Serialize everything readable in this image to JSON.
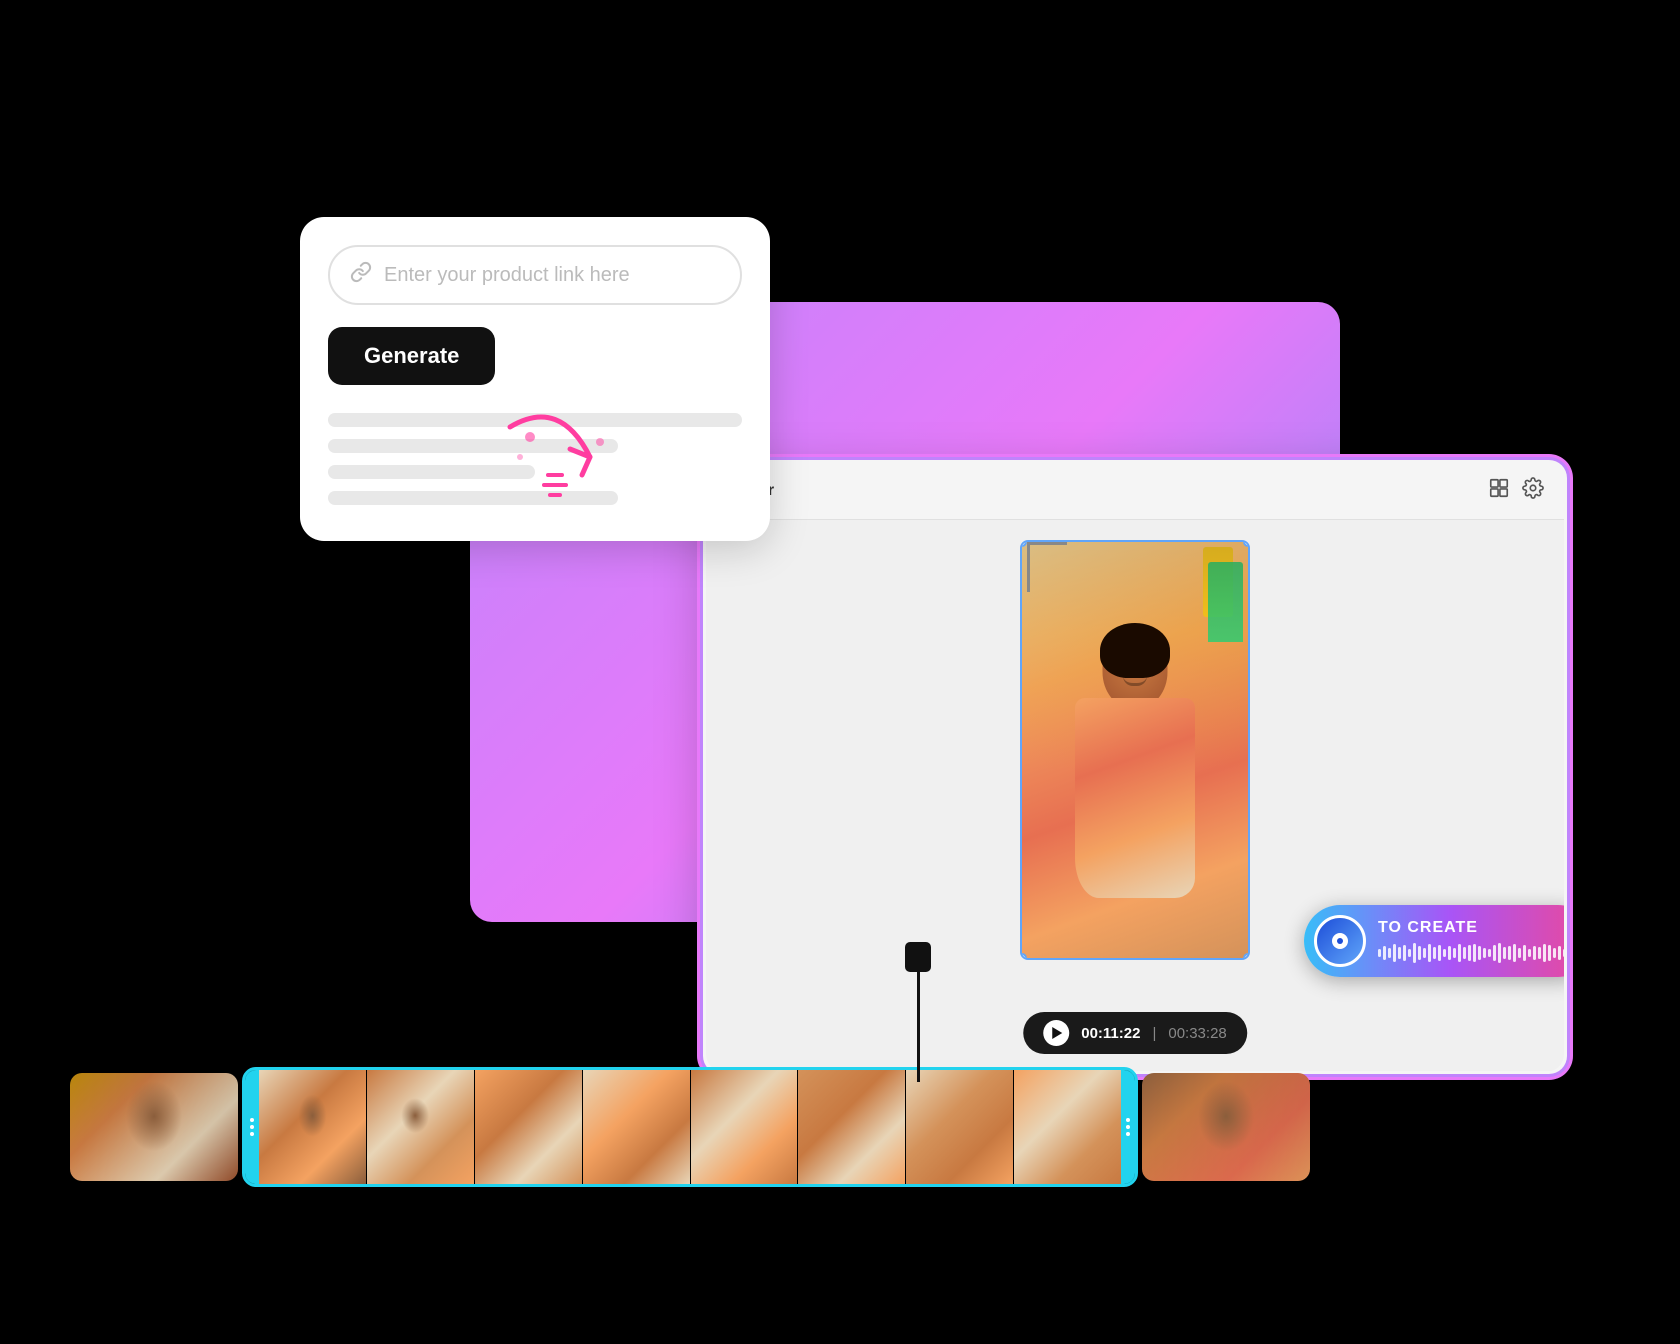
{
  "background": "#000000",
  "product_card": {
    "placeholder": "Enter your product link here",
    "generate_button": "Generate"
  },
  "player": {
    "label": "Player",
    "time_current": "00:11:22",
    "time_total": "00:33:28"
  },
  "music_badge": {
    "label": "TO CREATE",
    "waveform_bars": [
      8,
      14,
      10,
      18,
      12,
      16,
      8,
      20,
      14,
      10,
      18,
      12,
      16,
      8,
      14,
      10,
      18,
      12,
      16,
      18,
      14,
      10,
      8,
      16,
      20,
      12,
      14,
      18,
      10,
      16,
      8,
      14,
      12,
      18,
      16,
      10,
      14,
      8,
      18,
      12
    ]
  },
  "icons": {
    "link": "🔗",
    "layout": "⊞",
    "settings": "⚙",
    "play": "▶"
  }
}
